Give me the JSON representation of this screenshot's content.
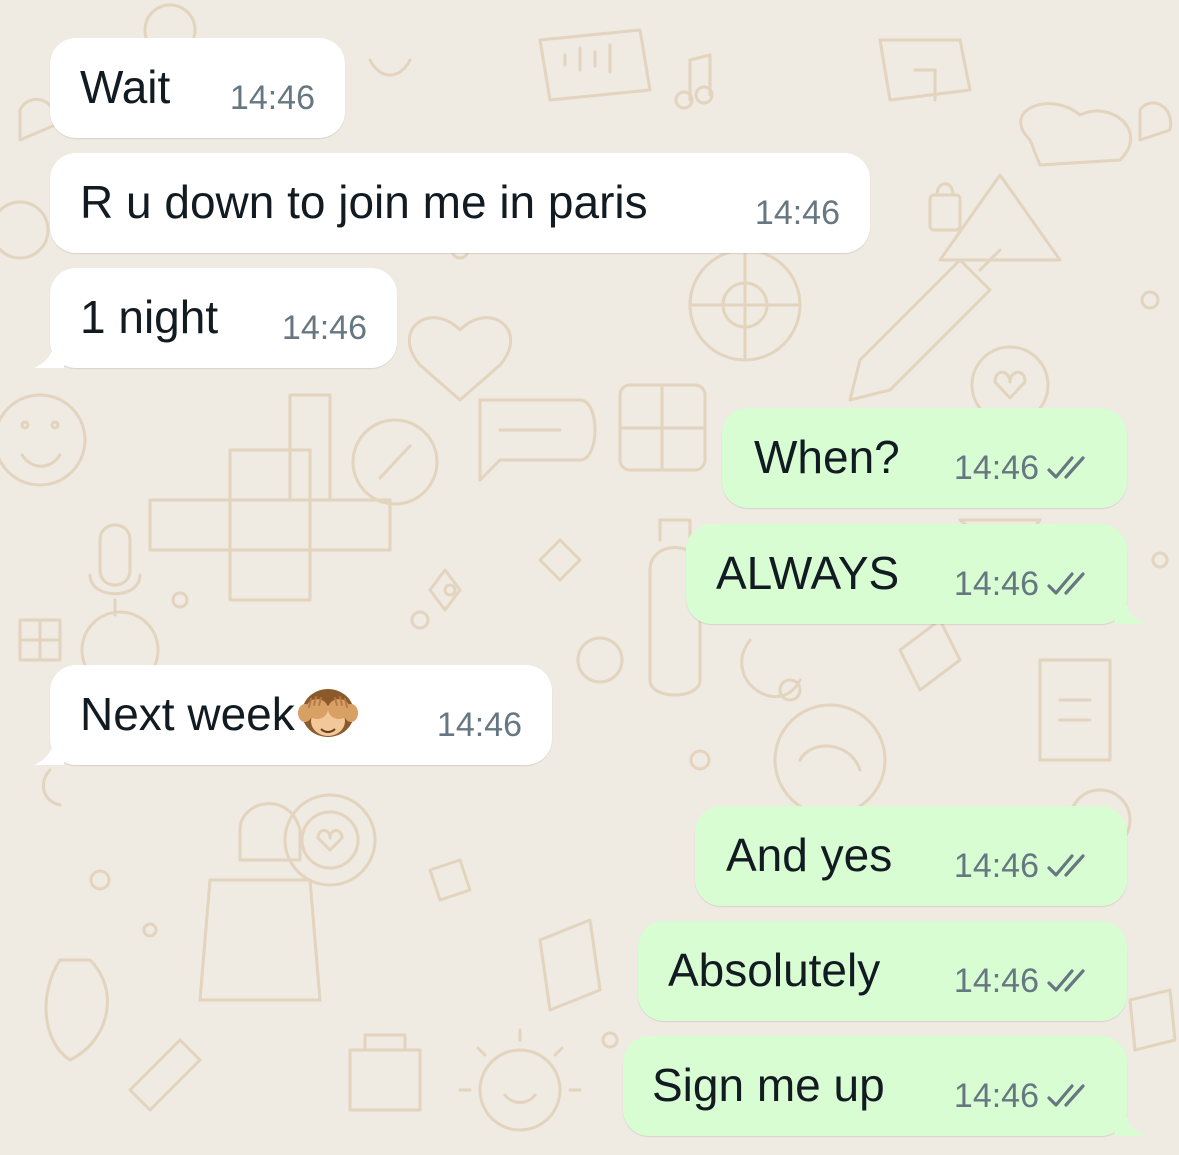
{
  "messages": [
    {
      "id": "m1",
      "direction": "incoming",
      "text": "Wait",
      "time": "14:46"
    },
    {
      "id": "m2",
      "direction": "incoming",
      "text": "R u down to join me in paris",
      "time": "14:46"
    },
    {
      "id": "m3",
      "direction": "incoming",
      "text": "1 night",
      "time": "14:46"
    },
    {
      "id": "m4",
      "direction": "outgoing",
      "text": "When?",
      "time": "14:46",
      "status": "double-check-icon"
    },
    {
      "id": "m5",
      "direction": "outgoing",
      "text": "ALWAYS",
      "time": "14:46",
      "status": "double-check-icon"
    },
    {
      "id": "m6",
      "direction": "incoming",
      "text": "Next week",
      "emoji": "see-no-evil-monkey",
      "time": "14:46"
    },
    {
      "id": "m7",
      "direction": "outgoing",
      "text": "And yes",
      "time": "14:46",
      "status": "double-check-icon"
    },
    {
      "id": "m8",
      "direction": "outgoing",
      "text": "Absolutely",
      "time": "14:46",
      "status": "double-check-icon"
    },
    {
      "id": "m9",
      "direction": "outgoing",
      "text": "Sign me up",
      "time": "14:46",
      "status": "double-check-icon"
    }
  ],
  "colors": {
    "background": "#efeae2",
    "doodle": "#e3d4be",
    "incoming_bubble": "#ffffff",
    "outgoing_bubble": "#d9fdd3",
    "text": "#111b21",
    "timestamp": "#667781",
    "tick": "#667781"
  }
}
